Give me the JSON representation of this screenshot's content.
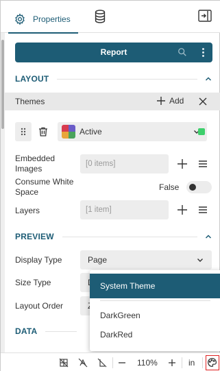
{
  "tabs": {
    "properties_label": "Properties"
  },
  "report_bar": {
    "title": "Report"
  },
  "sections": {
    "layout": "LAYOUT",
    "preview": "PREVIEW",
    "data": "DATA"
  },
  "themes": {
    "label": "Themes",
    "add_label": "Add",
    "active_theme": "Active"
  },
  "properties": {
    "embedded_images": {
      "label": "Embedded Images",
      "value": "[0 items]"
    },
    "consume_white_space": {
      "label": "Consume White Space",
      "value": "False"
    },
    "layers": {
      "label": "Layers",
      "value": "[1 item]"
    },
    "display_type": {
      "label": "Display Type",
      "value": "Page"
    },
    "size_type": {
      "label": "Size Type",
      "value": "D"
    },
    "layout_order": {
      "label": "Layout Order",
      "value": "Z"
    }
  },
  "theme_popup": {
    "header": "System Theme",
    "options": [
      "DarkGreen",
      "DarkRed"
    ]
  },
  "statusbar": {
    "zoom": "110%",
    "unit": "in"
  },
  "colors": {
    "accent": "#1d5c75",
    "toggle_knob": "#333333",
    "status_green": "#3ecf6c",
    "highlight_red": "#e02020"
  }
}
